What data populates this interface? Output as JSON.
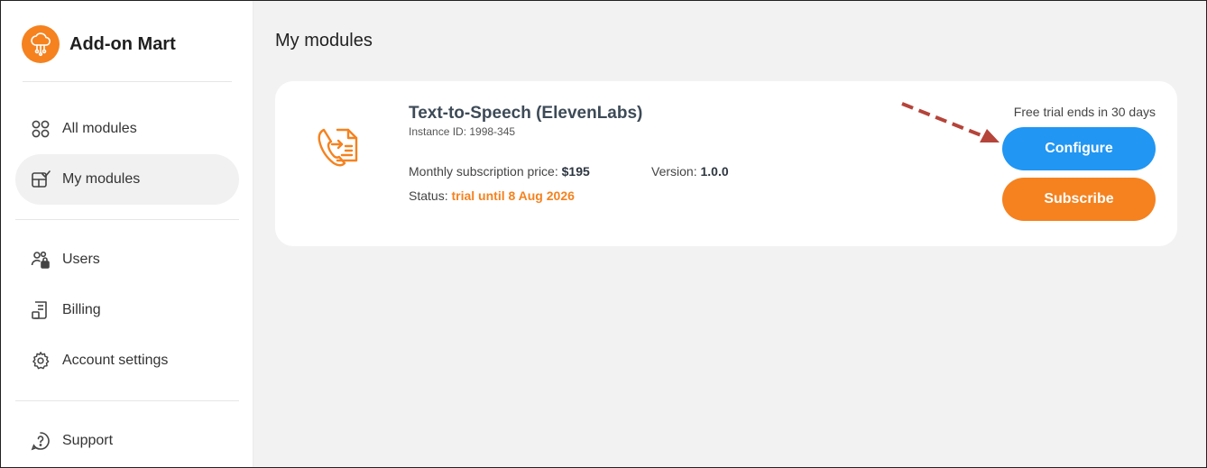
{
  "app": {
    "name": "Add-on Mart"
  },
  "sidebar": {
    "items": [
      {
        "label": "All modules",
        "icon": "grid-circles-icon"
      },
      {
        "label": "My modules",
        "icon": "my-modules-icon",
        "active": true
      },
      {
        "label": "Users",
        "icon": "users-lock-icon"
      },
      {
        "label": "Billing",
        "icon": "billing-icon"
      },
      {
        "label": "Account settings",
        "icon": "gear-icon"
      },
      {
        "label": "Support",
        "icon": "help-circle-icon"
      }
    ]
  },
  "main": {
    "title": "My modules",
    "module": {
      "name": "Text-to-Speech (ElevenLabs)",
      "instance_id": "Instance ID: 1998-345",
      "price_label": "Monthly subscription price:",
      "price_value": "$195",
      "version_label": "Version:",
      "version_value": "1.0.0",
      "status_label": "Status:",
      "status_value": "trial until 8 Aug 2026",
      "trial_note": "Free trial ends in 30 days",
      "configure_label": "Configure",
      "subscribe_label": "Subscribe"
    }
  },
  "colors": {
    "accent_orange": "#f5821f",
    "accent_blue": "#2196f3",
    "annotation_arrow": "#b5443a"
  }
}
